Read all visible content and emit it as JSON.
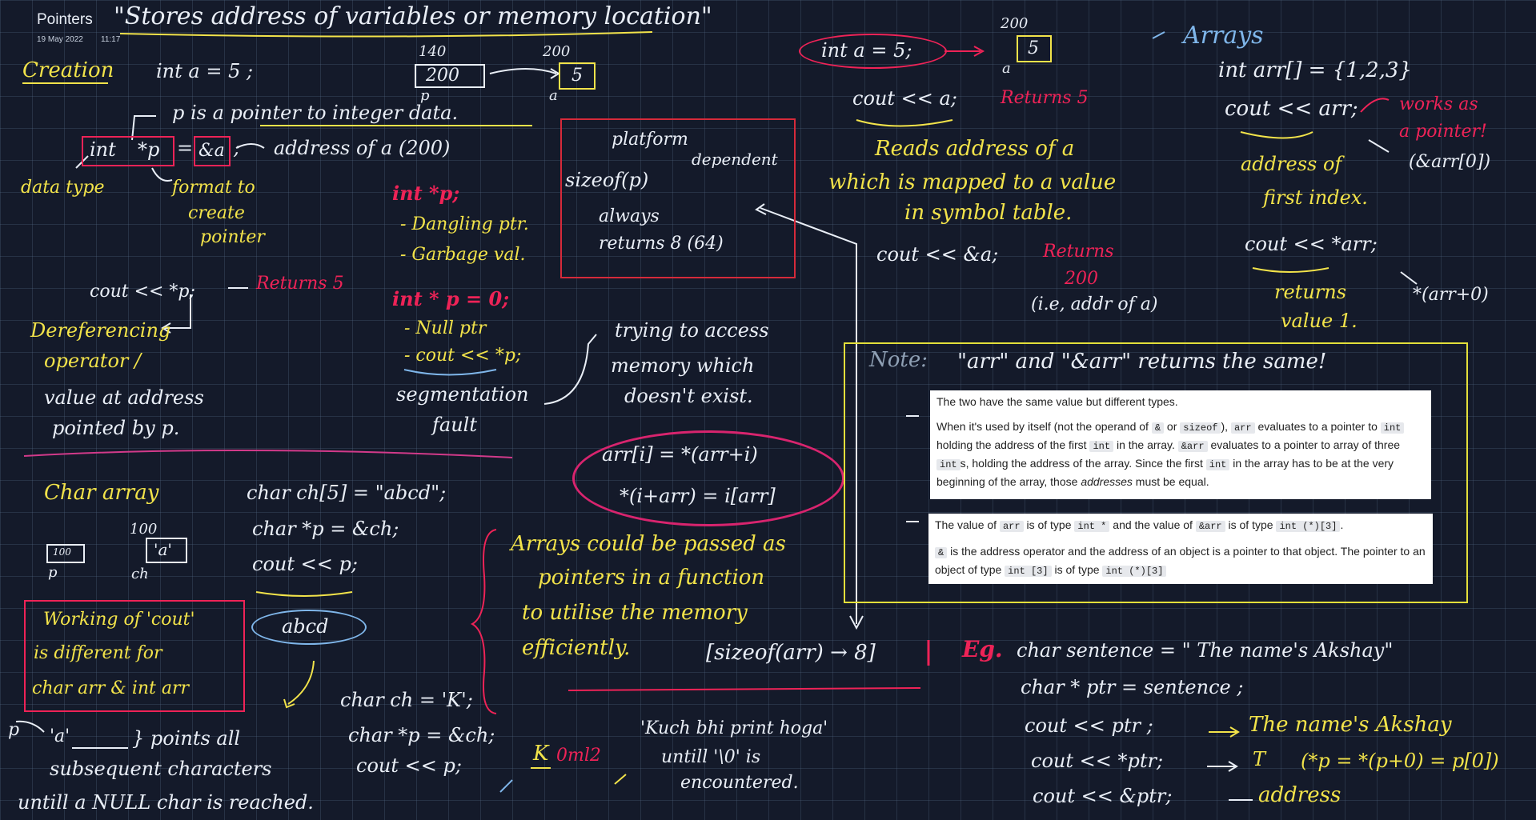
{
  "header": {
    "title": "Pointers",
    "date": "19 May 2022",
    "time": "11:17"
  },
  "title_note": "\"Stores address of variables or memory location\"",
  "creation": {
    "label": "Creation",
    "stmt": "int a = 5 ;",
    "mem_addr_p": "140",
    "mem_val_p": "200",
    "mem_name_p": "p",
    "mem_addr_a": "200",
    "mem_val_a": "5",
    "mem_name_a": "a",
    "pointer_note": "p is a pointer to integer data.",
    "decl_type": "int",
    "decl_ptr": "*p",
    "decl_eq": "=",
    "decl_rhs": "&a",
    "decl_semicolon": ";",
    "address_note": "address of a (200)",
    "data_type": "data type",
    "format_note_1": "format to",
    "format_note_2": "create",
    "format_note_3": "pointer"
  },
  "deref": {
    "stmt": "cout << *p;",
    "returns": "Returns 5",
    "l1": "Dereferencing",
    "l2": "operator /",
    "l3": "value at address",
    "l4": "pointed by p."
  },
  "dangling": {
    "stmt1": "int *p;",
    "b1": "- Dangling ptr.",
    "b2": "- Garbage val.",
    "stmt2": "int * p = 0;",
    "b3": "- Null ptr",
    "b4": "- cout << *p;",
    "seg1": "segmentation",
    "seg2": "fault",
    "access1": "trying to access",
    "access2": "memory which",
    "access3": "doesn't exist."
  },
  "sizeof_box": {
    "l1": "platform",
    "l2": "dependent",
    "l3": "sizeof(p)",
    "l4": "always",
    "l5": "returns 8 (64)"
  },
  "equiv": {
    "l1": "arr[i] = *(arr+i)",
    "l2": "*(i+arr) = i[arr]"
  },
  "middle": {
    "stmt": "int a = 5;",
    "addr": "200",
    "val": "5",
    "name": "a",
    "cout": "cout << a;",
    "returns": "Returns 5",
    "r1": "Reads address of a",
    "r2": "which is mapped to a value",
    "r3": "in symbol table.",
    "cout2": "cout << &a;",
    "ret2a": "Returns",
    "ret2b": "200",
    "ret2c": "(i.e, addr of a)"
  },
  "arrays": {
    "title": "Arrays",
    "decl": "int arr[] = {1,2,3}",
    "cout": "cout << arr;",
    "works1": "works as",
    "works2": "a pointer!",
    "addr1": "address of",
    "addr2": "first index.",
    "addr_eq": "(&arr[0])",
    "cout2": "cout << *arr;",
    "ret1": "returns",
    "ret2": "value 1.",
    "eq2": "*(arr+0)"
  },
  "note": {
    "label": "Note:",
    "text": "\"arr\" and \"&arr\" returns the same!",
    "q1_p1": "The two have the same value but different types.",
    "q1_p2a": "When it's used by itself (not the operand of",
    "q1_amp": "&",
    "q1_or": "or",
    "q1_sizeof": "sizeof",
    "q1_p2b": "),",
    "q1_arr": "arr",
    "q1_p2c": "evaluates to a pointer to",
    "q1_int": "int",
    "q1_p2d": "holding the address of the first",
    "q1_p2e": "in the array.",
    "q1_amparr": "&arr",
    "q1_p2f": "evaluates to a pointer to array of three",
    "q1_p2g": "s, holding the address of the array. Since the first",
    "q1_p2h": "in the array has to be at the very",
    "q1_p2i": "beginning of the array, those",
    "q1_addresses": "addresses",
    "q1_p2j": "must be equal.",
    "q2_a": "The value of",
    "q2_arr": "arr",
    "q2_b": "is of type",
    "q2_intp": "int *",
    "q2_c": "and the value of",
    "q2_amparr": "&arr",
    "q2_d": "is of type",
    "q2_intarr": "int (*)[3]",
    "q2_e": ".",
    "q3_amp": "&",
    "q3_a": "is the address operator and the address of an object is a pointer to that object. The pointer to an",
    "q3_b": "object of type",
    "q3_int3": "int [3]",
    "q3_c": "is of type",
    "q3_intp3": "int (*)[3]"
  },
  "char_array": {
    "label": "Char array",
    "decl": "char ch[5] = \"abcd\";",
    "ptr": "char *p = &ch;",
    "cout": "cout << p;",
    "output": "abcd",
    "addr_p": "100",
    "addr_ch": "100",
    "val_ch": "'a'",
    "name_p": "p",
    "name_ch": "ch",
    "box1": "Working of 'cout'",
    "box2": "is different for",
    "box3": "char arr & int arr",
    "p_arrow": "p",
    "pa": "'a'",
    "points1": "} points all",
    "points2": "subsequent characters",
    "points3": "untill a NULL char is reached."
  },
  "char_single": {
    "l1": "char ch = 'K';",
    "l2": "char *p = &ch;",
    "l3": "cout << p;",
    "k": "K",
    "garbage": "0ml2",
    "kuch1": "'Kuch bhi print hoga'",
    "kuch2": "untill '\\0' is",
    "kuch3": "encountered."
  },
  "passing": {
    "l1": "Arrays could be passed as",
    "l2": "pointers in a function",
    "l3": "to utilise the memory",
    "l4": "efficiently.",
    "sizeof": "[sizeof(arr) → 8]"
  },
  "example": {
    "label": "Eg.",
    "l1": "char sentence = \" The name's Akshay\"",
    "l2": "char * ptr = sentence ;",
    "l3": "cout << ptr ;",
    "o3": "The name's Akshay",
    "l4": "cout << *ptr;",
    "o4": "T",
    "o4b": "(*p = *(p+0) = p[0])",
    "l5": "cout << &ptr;",
    "o5": "address"
  },
  "colors": {
    "bg": "#141a2a",
    "yellow": "#f2e34a",
    "red": "#ee2357",
    "white": "#e9eef6",
    "blue": "#7fb6ea"
  }
}
